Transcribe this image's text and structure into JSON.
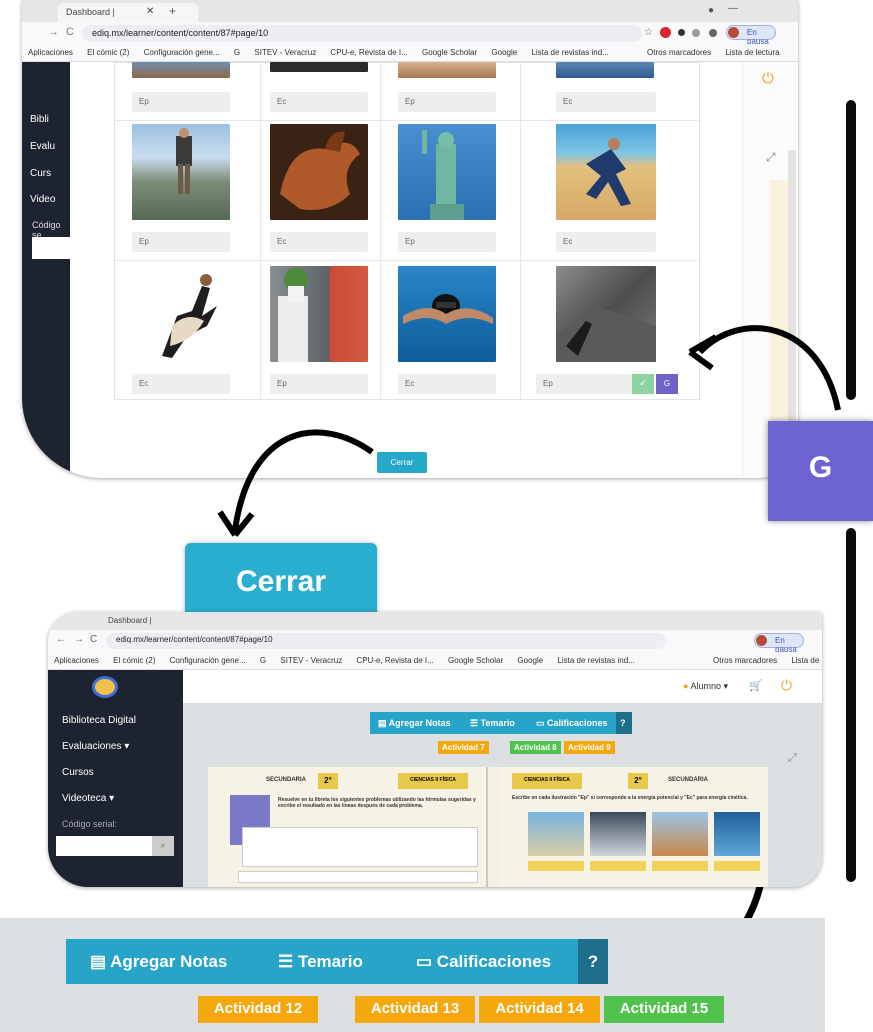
{
  "browser_top": {
    "tab_title": "Dashboard |",
    "url": "ediq.mx/learner/content/content/87#page/10",
    "status": "En pausa",
    "bookmarks": [
      "Aplicaciones",
      "El cómic (2)",
      "Configuración gene...",
      "G",
      "SITEV - Veracruz",
      "CPU-e, Revista de I...",
      "Google Scholar",
      "Google",
      "Lista de revistas ind...",
      "Otros marcadores",
      "Lista de lectura"
    ]
  },
  "browser_bottom": {
    "tab_title": "Dashboard |",
    "url": "ediq.mx/learner/content/content/87#page/10",
    "status": "En pausa"
  },
  "sidebar_top": {
    "items": [
      "Bibli",
      "Evalu",
      "Curs",
      "Video"
    ],
    "serial_label": "Código se"
  },
  "sidebar": {
    "items": [
      "Biblioteca Digital",
      "Evaluaciones ▾",
      "Cursos",
      "Videoteca ▾"
    ],
    "serial_label": "Código serial:"
  },
  "header": {
    "user": "Alumno ▾"
  },
  "grid": {
    "row1_answers": [
      "Ep",
      "Ec",
      "Ep",
      "Ec"
    ],
    "row2_answers": [
      "Ep",
      "Ec",
      "Ep",
      "Ec"
    ],
    "row3_answers": [
      "Ec",
      "Ep",
      "Ec",
      "Ep"
    ],
    "check_label": "✓",
    "g_label": "G",
    "images": [
      "hiker-mountains",
      "horse",
      "statue-of-liberty",
      "runner-beach",
      "dancers",
      "plant-balcony",
      "swimmer",
      "skydiver-city"
    ]
  },
  "modal": {
    "close_label": "Cerrar"
  },
  "zoom": {
    "g_label": "G",
    "close_label": "Cerrar"
  },
  "toolbar": {
    "add_notes": "Agregar Notas",
    "syllabus": "Temario",
    "grades": "Calificaciones",
    "help": "?"
  },
  "activities_small": [
    {
      "label": "Actividad 7",
      "color": "#f5a70e"
    },
    {
      "label": "Actividad 8",
      "color": "#52c24f"
    },
    {
      "label": "Actividad 9",
      "color": "#f5a70e"
    }
  ],
  "activities_zoom": [
    {
      "label": "Actividad 12",
      "color": "#f5a70e"
    },
    {
      "label": "Actividad 13",
      "color": "#f5a70e"
    },
    {
      "label": "Actividad 14",
      "color": "#f5a70e"
    },
    {
      "label": "Actividad 15",
      "color": "#52c24f"
    }
  ],
  "book": {
    "left_grade": "2°",
    "left_level": "SECUNDARIA",
    "subject": "CIENCIAS II FÍSICA",
    "left_intro": "Resuelve en tu libreta los siguientes problemas utilizando las fórmulas sugeridas y escribe el resultado en las líneas después de cada problema.",
    "right_intro": "Escribe en cada ilustración \"Ep\" si corresponde a la energía potencial y \"Ec\" para energía cinética."
  },
  "colors": {
    "accent": "#27a4c7",
    "violet": "#6e64d0",
    "sidebar": "#1d2330",
    "orange": "#f5a70e",
    "green": "#52c24f"
  }
}
